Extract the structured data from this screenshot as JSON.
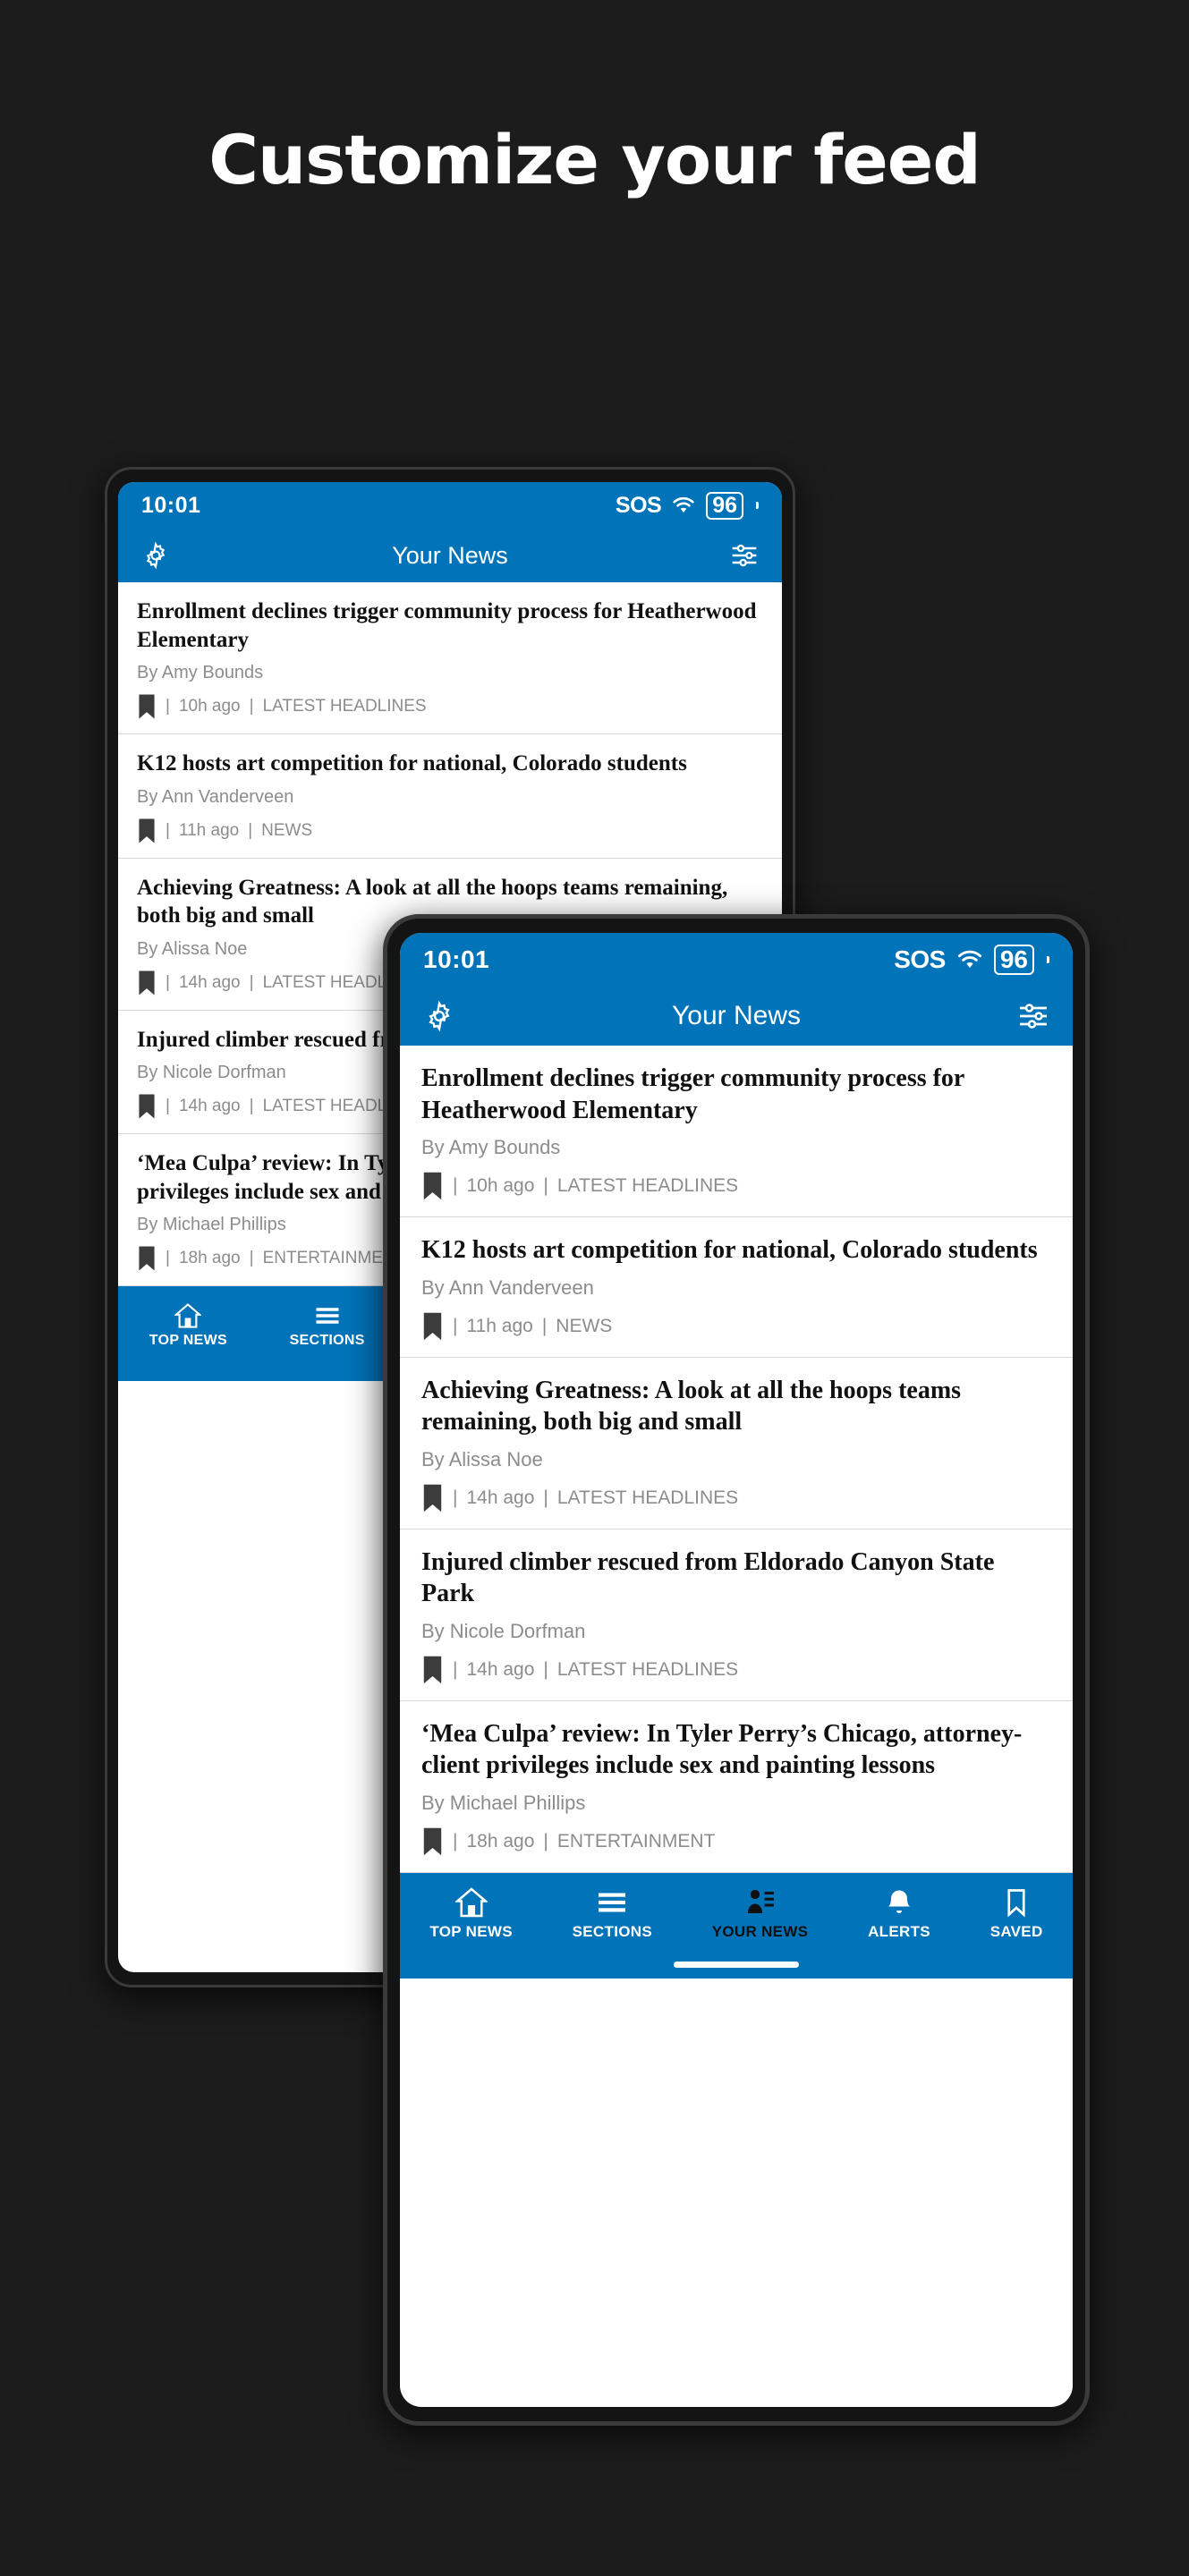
{
  "promo": {
    "title": "Customize your feed"
  },
  "colors": {
    "brand_blue": "#0173b8",
    "page_background": "#1c1c1c",
    "active_nav": "#101010"
  },
  "status_bar": {
    "time": "10:01",
    "sos_label": "SOS",
    "wifi_icon": "wifi-icon",
    "battery_level": "96"
  },
  "app_bar": {
    "settings_icon": "gear-icon",
    "title": "Your News",
    "filter_icon": "tune-sliders-icon"
  },
  "articles": [
    {
      "headline": "Enrollment declines trigger community process for Heatherwood Elementary",
      "byline": "By Amy Bounds",
      "time": "10h ago",
      "section": "LATEST HEADLINES",
      "bookmark_icon": "bookmark-icon"
    },
    {
      "headline": "K12 hosts art competition for national, Colorado students",
      "byline": "By Ann Vanderveen",
      "time": "11h ago",
      "section": "NEWS",
      "bookmark_icon": "bookmark-icon"
    },
    {
      "headline": "Achieving Greatness: A look at all the hoops teams remaining, both big and small",
      "byline": "By Alissa Noe",
      "time": "14h ago",
      "section": "LATEST HEADLINES",
      "bookmark_icon": "bookmark-icon"
    },
    {
      "headline": "Injured climber rescued from Eldorado Canyon State Park",
      "byline": "By Nicole Dorfman",
      "time": "14h ago",
      "section": "LATEST HEADLINES",
      "bookmark_icon": "bookmark-icon"
    },
    {
      "headline": "‘Mea Culpa’ review: In Tyler Perry’s Chicago, attorney-client privileges include sex and painting lessons",
      "byline": "By Michael Phillips",
      "time": "18h ago",
      "section": "ENTERTAINMENT",
      "bookmark_icon": "bookmark-icon"
    }
  ],
  "separator": "|",
  "bottom_nav": {
    "items": [
      {
        "label": "TOP NEWS",
        "icon": "home-icon",
        "active": false
      },
      {
        "label": "SECTIONS",
        "icon": "hamburger-menu-icon",
        "active": false
      },
      {
        "label": "YOUR NEWS",
        "icon": "person-list-icon",
        "active": true
      },
      {
        "label": "ALERTS",
        "icon": "bell-icon",
        "active": false
      },
      {
        "label": "SAVED",
        "icon": "bookmark-outline-icon",
        "active": false
      }
    ]
  }
}
